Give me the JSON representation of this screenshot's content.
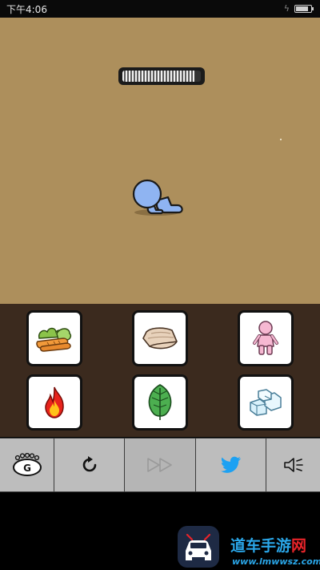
{
  "status_bar": {
    "time": "下午4:06",
    "battery_level": 0.85
  },
  "game": {
    "progress": 0.92,
    "items": [
      {
        "name": "vegetables",
        "icon": "vegetables-icon"
      },
      {
        "name": "cloth",
        "icon": "cloth-icon"
      },
      {
        "name": "doll",
        "icon": "pink-doll-icon"
      },
      {
        "name": "fire",
        "icon": "fire-icon"
      },
      {
        "name": "leaf",
        "icon": "leaf-icon"
      },
      {
        "name": "ice",
        "icon": "ice-cubes-icon"
      }
    ]
  },
  "toolbar": {
    "buttons": [
      {
        "name": "logo",
        "icon": "game-logo-icon",
        "enabled": true
      },
      {
        "name": "restart",
        "icon": "restart-icon",
        "enabled": true
      },
      {
        "name": "skip",
        "icon": "fast-forward-icon",
        "enabled": false
      },
      {
        "name": "share",
        "icon": "twitter-icon",
        "enabled": true
      },
      {
        "name": "sound",
        "icon": "speaker-icon",
        "enabled": true
      }
    ]
  },
  "watermark": {
    "title_part1": "道车手游",
    "title_part2": "网",
    "url": "www.lmwwsz.com",
    "colors": {
      "blue": "#2aa6e8",
      "red": "#e8242a"
    }
  },
  "colors": {
    "ground": "#ad8f5c",
    "panel": "#3b2a1e",
    "character": "#8fb4f2"
  }
}
